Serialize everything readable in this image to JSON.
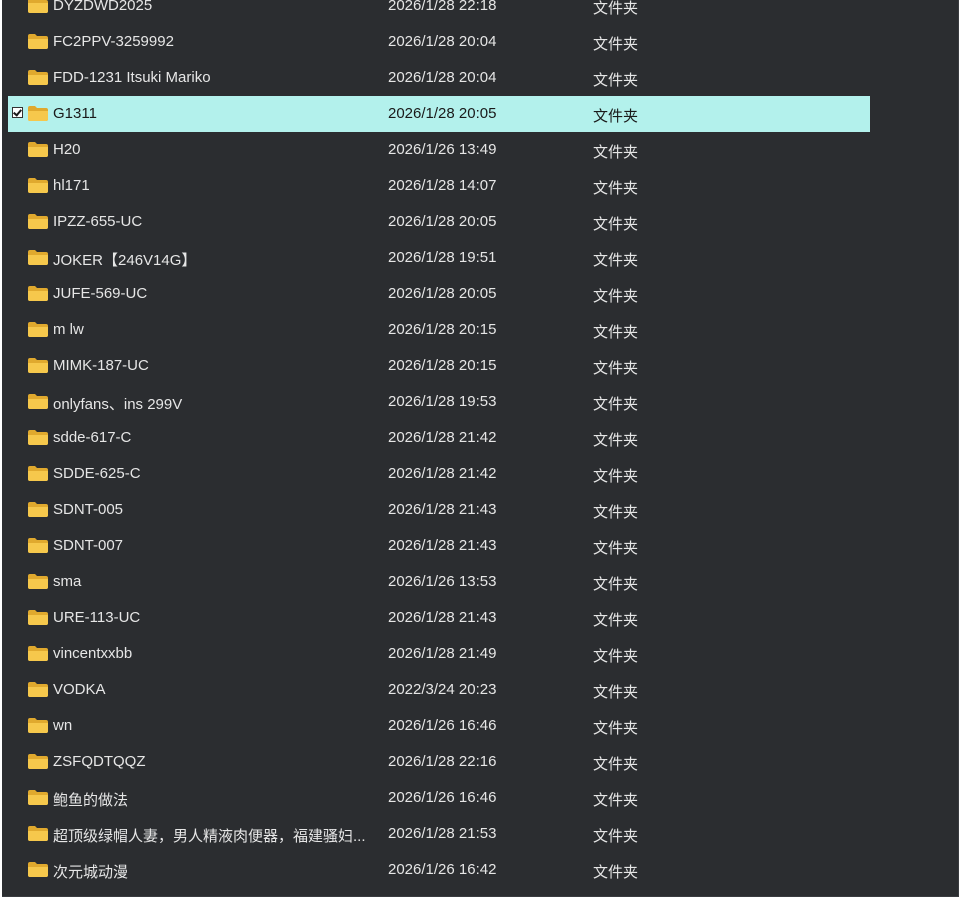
{
  "colors": {
    "background": "#2b2d30",
    "selected_row": "#b3f1ec",
    "folder": "#f6c84c"
  },
  "files": [
    {
      "name": "DYZDWD2025",
      "date": "2026/1/28 22:18",
      "type": "文件夹",
      "icon": "folder-icon"
    },
    {
      "name": "FC2PPV-3259992",
      "date": "2026/1/28 20:04",
      "type": "文件夹",
      "icon": "folder-icon"
    },
    {
      "name": "FDD-1231 Itsuki Mariko",
      "date": "2026/1/28 20:04",
      "type": "文件夹",
      "icon": "folder-icon"
    },
    {
      "name": "G1311",
      "date": "2026/1/28 20:05",
      "type": "文件夹",
      "icon": "folder-icon",
      "selected": true
    },
    {
      "name": "H20",
      "date": "2026/1/26 13:49",
      "type": "文件夹",
      "icon": "folder-icon"
    },
    {
      "name": "hl171",
      "date": "2026/1/28 14:07",
      "type": "文件夹",
      "icon": "folder-icon"
    },
    {
      "name": "IPZZ-655-UC",
      "date": "2026/1/28 20:05",
      "type": "文件夹",
      "icon": "folder-icon"
    },
    {
      "name": "JOKER【246V14G】",
      "date": "2026/1/28 19:51",
      "type": "文件夹",
      "icon": "folder-icon"
    },
    {
      "name": "JUFE-569-UC",
      "date": "2026/1/28 20:05",
      "type": "文件夹",
      "icon": "folder-icon"
    },
    {
      "name": "m lw",
      "date": "2026/1/28 20:15",
      "type": "文件夹",
      "icon": "folder-icon"
    },
    {
      "name": "MIMK-187-UC",
      "date": "2026/1/28 20:15",
      "type": "文件夹",
      "icon": "folder-icon"
    },
    {
      "name": "onlyfans、ins 299V",
      "date": "2026/1/28 19:53",
      "type": "文件夹",
      "icon": "folder-icon"
    },
    {
      "name": "sdde-617-C",
      "date": "2026/1/28 21:42",
      "type": "文件夹",
      "icon": "folder-icon"
    },
    {
      "name": "SDDE-625-C",
      "date": "2026/1/28 21:42",
      "type": "文件夹",
      "icon": "folder-icon"
    },
    {
      "name": "SDNT-005",
      "date": "2026/1/28 21:43",
      "type": "文件夹",
      "icon": "folder-icon"
    },
    {
      "name": "SDNT-007",
      "date": "2026/1/28 21:43",
      "type": "文件夹",
      "icon": "folder-icon"
    },
    {
      "name": "sma",
      "date": "2026/1/26 13:53",
      "type": "文件夹",
      "icon": "folder-icon"
    },
    {
      "name": "URE-113-UC",
      "date": "2026/1/28 21:43",
      "type": "文件夹",
      "icon": "folder-icon"
    },
    {
      "name": "vincentxxbb",
      "date": "2026/1/28 21:49",
      "type": "文件夹",
      "icon": "folder-icon"
    },
    {
      "name": "VODKA",
      "date": "2022/3/24 20:23",
      "type": "文件夹",
      "icon": "folder-icon"
    },
    {
      "name": "wn",
      "date": "2026/1/26 16:46",
      "type": "文件夹",
      "icon": "folder-icon"
    },
    {
      "name": "ZSFQDTQQZ",
      "date": "2026/1/28 22:16",
      "type": "文件夹",
      "icon": "folder-icon"
    },
    {
      "name": "鲍鱼的做法",
      "date": "2026/1/26 16:46",
      "type": "文件夹",
      "icon": "folder-icon"
    },
    {
      "name": "超顶级绿帽人妻，男人精液肉便器，福建骚妇...",
      "date": "2026/1/28 21:53",
      "type": "文件夹",
      "icon": "folder-icon"
    },
    {
      "name": "次元城动漫",
      "date": "2026/1/26 16:42",
      "type": "文件夹",
      "icon": "folder-icon"
    }
  ]
}
